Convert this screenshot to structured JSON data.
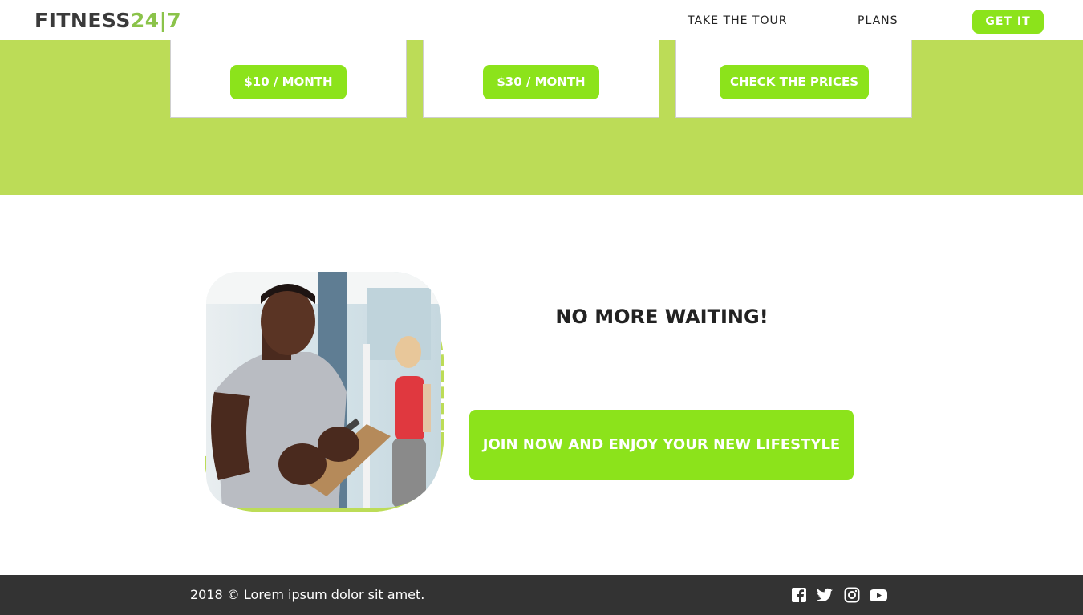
{
  "brand": {
    "part1": "FITNESS",
    "part2": "24|7"
  },
  "nav": {
    "tour": "TAKE THE TOUR",
    "plans": "PLANS",
    "cta": "GET IT"
  },
  "plans": [
    {
      "label": "$10 / MONTH"
    },
    {
      "label": "$30 / MONTH"
    },
    {
      "label": "CHECK THE PRICES"
    }
  ],
  "promo": {
    "headline": "NO MORE WAITING!",
    "cta": "JOIN NOW AND ENJOY YOUR NEW LIFESTYLE"
  },
  "footer": {
    "copyright": "2018 © Lorem ipsum dolor sit amet.",
    "social": [
      "facebook-icon",
      "twitter-icon",
      "instagram-icon",
      "youtube-icon"
    ]
  },
  "colors": {
    "accent": "#8ce31b",
    "band": "#bcdc57",
    "footer": "#333333",
    "logo_dark": "#3a3a3a",
    "logo_green": "#8bc34a"
  }
}
